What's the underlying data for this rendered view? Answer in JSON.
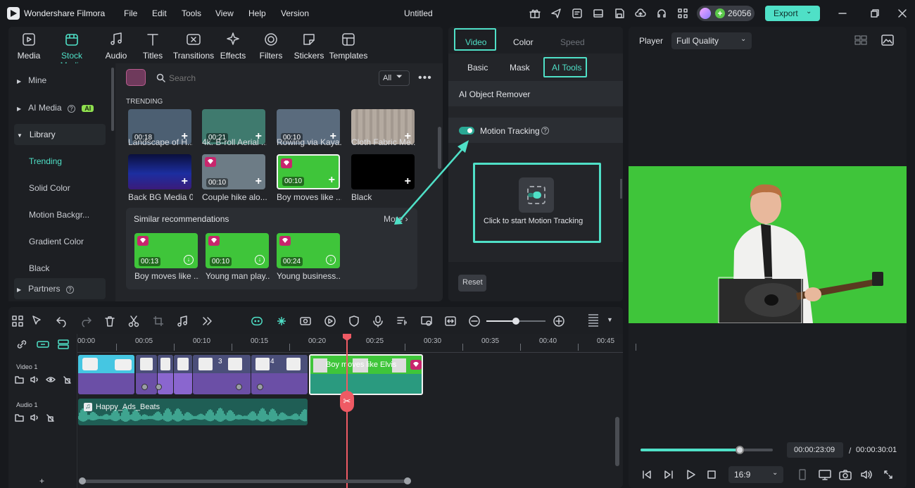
{
  "app": {
    "name": "Wondershare Filmora",
    "title": "Untitled",
    "credits": "26056",
    "export_label": "Export"
  },
  "menu": [
    "File",
    "Edit",
    "Tools",
    "View",
    "Help",
    "Version"
  ],
  "toolbar": [
    {
      "label": "Media",
      "icon": "media-icon"
    },
    {
      "label": "Stock Media",
      "icon": "stock-media-icon"
    },
    {
      "label": "Audio",
      "icon": "music-note-icon"
    },
    {
      "label": "Titles",
      "icon": "text-t-icon"
    },
    {
      "label": "Transitions",
      "icon": "transition-icon"
    },
    {
      "label": "Effects",
      "icon": "effects-icon"
    },
    {
      "label": "Filters",
      "icon": "filter-icon"
    },
    {
      "label": "Stickers",
      "icon": "sticker-icon"
    },
    {
      "label": "Templates",
      "icon": "template-icon"
    }
  ],
  "sidebar": [
    {
      "label": "Mine"
    },
    {
      "label": "AI Media",
      "badge": "AI"
    },
    {
      "label": "Library"
    },
    {
      "label": "Trending"
    },
    {
      "label": "Solid Color"
    },
    {
      "label": "Motion Backgr..."
    },
    {
      "label": "Gradient Color"
    },
    {
      "label": "Black"
    },
    {
      "label": "Partners"
    }
  ],
  "search": {
    "placeholder": "Search",
    "filter_label": "All"
  },
  "section": {
    "trending": "TRENDING",
    "similar": "Similar recommendations",
    "more": "More"
  },
  "media": [
    {
      "label": "Landscape of H...",
      "duration": "00:18",
      "color": "#4c5f72"
    },
    {
      "label": "4k. B-roll Aerial ...",
      "duration": "00:21",
      "color": "#3f7a6e"
    },
    {
      "label": "Rowing via Kaya...",
      "duration": "00:10",
      "color": "#5a6b7d"
    },
    {
      "label": "Cloth Fabric Me...",
      "duration": "",
      "color": "#a79c92"
    },
    {
      "label": "Back BG Media 01",
      "duration": "",
      "color": "#16206e"
    },
    {
      "label": "Couple hike alo...",
      "duration": "00:10",
      "color": "#6d7c86"
    },
    {
      "label": "Boy moves like ...",
      "duration": "00:10",
      "color": "#3fc53a"
    },
    {
      "label": "Black",
      "duration": "",
      "color": "#000000"
    }
  ],
  "similar": [
    {
      "label": "Boy moves like ...",
      "duration": "00:13"
    },
    {
      "label": "Young man play...",
      "duration": "00:10"
    },
    {
      "label": "Young business...",
      "duration": "00:24"
    }
  ],
  "props": {
    "tabs": [
      "Video",
      "Color",
      "Speed"
    ],
    "subtabs": [
      "Basic",
      "Mask",
      "AI Tools"
    ],
    "remover": "AI Object Remover",
    "tracking": "Motion Tracking",
    "tracking_btn": "Click to start Motion Tracking",
    "reset": "Reset"
  },
  "player": {
    "label": "Player",
    "quality": "Full Quality",
    "current": "00:00:23:09",
    "separator": "/",
    "total": "00:00:30:01",
    "ratio": "16:9",
    "progress": 0.75
  },
  "timeline": {
    "ruler": [
      "00:00",
      "00:05",
      "00:10",
      "00:15",
      "00:20",
      "00:25",
      "00:30",
      "00:35",
      "00:40",
      "00:45"
    ],
    "video_track": "Video 1",
    "audio_track": "Audio 1",
    "clip_label": "Boy moves like Elvis",
    "audio_label": "Happy_Ads_Beats",
    "clip_numbers": [
      "3",
      "4"
    ]
  },
  "colors": {
    "accent": "#4fe0c7",
    "green_screen": "#3fc53a",
    "playhead": "#ef5a64",
    "clip_purple": "#6b4fa6"
  }
}
